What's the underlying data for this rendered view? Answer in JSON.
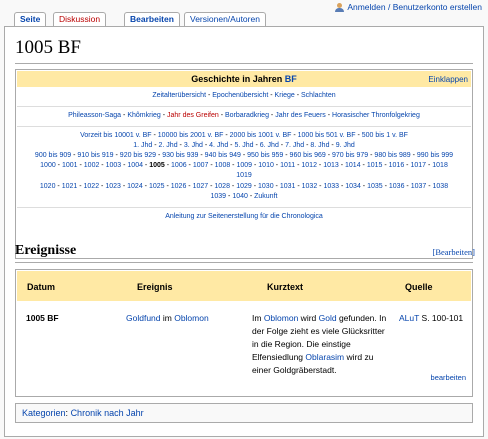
{
  "tabs": {
    "seite": "Seite",
    "diskussion": "Diskussion",
    "bearbeiten": "Bearbeiten",
    "versionen": "Versionen/Autoren"
  },
  "user_tools": {
    "login": "Anmelden / Benutzerkonto erstellen"
  },
  "page": {
    "title": "1005 BF"
  },
  "navbox": {
    "title_prefix": "Geschichte in Jahren",
    "title_link": "BF",
    "collapse": "Einklappen",
    "row1": [
      "Zeitalterübersicht",
      "Epochenübersicht",
      "Kriege",
      "Schlachten"
    ],
    "row2": [
      "Phileasson-Saga",
      "Khômkrieg",
      "Jahr des Greifen",
      "Borbaradkrieg",
      "Jahr des Feuers",
      "Horasischer Thronfolgekrieg"
    ],
    "row3": [
      "Vorzeit bis 10001 v. BF",
      "10000 bis 2001 v. BF",
      "2000 bis 1001 v. BF",
      "1000 bis 501 v. BF",
      "500 bis 1 v. BF"
    ],
    "row4": [
      "1. Jhd",
      "2. Jhd",
      "3. Jhd",
      "4. Jhd",
      "5. Jhd",
      "6. Jhd",
      "7. Jhd",
      "8. Jhd",
      "9. Jhd"
    ],
    "row5": [
      "900 bis 909",
      "910 bis 919",
      "920 bis 929",
      "930 bis 939",
      "940 bis 949",
      "950 bis 959",
      "960 bis 969",
      "970 bis 979",
      "980 bis 989",
      "990 bis 999"
    ],
    "row6": [
      "1000",
      "1001",
      "1002",
      "1003",
      "1004",
      "1005",
      "1006",
      "1007",
      "1008",
      "1009",
      "1010",
      "1011",
      "1012",
      "1013",
      "1014",
      "1015",
      "1016",
      "1017",
      "1018"
    ],
    "row7": [
      "1019"
    ],
    "row8": [
      "1020",
      "1021",
      "1022",
      "1023",
      "1024",
      "1025",
      "1026",
      "1027",
      "1028",
      "1029",
      "1030",
      "1031",
      "1032",
      "1033",
      "1034",
      "1035",
      "1036",
      "1037",
      "1038"
    ],
    "row9": [
      "1039",
      "1040",
      "Zukunft"
    ],
    "footer": "Anleitung zur Seitenerstellung für die Chronologica"
  },
  "section": {
    "title": "Ereignisse",
    "edit": "[Bearbeiten]"
  },
  "table": {
    "headers": [
      "Datum",
      "Ereignis",
      "Kurztext",
      "Quelle"
    ],
    "row": {
      "datum": "1005 BF",
      "ereignis_link1": "Goldfund",
      "ereignis_mid": " im ",
      "ereignis_link2": "Oblomon",
      "kurz_a": "Im ",
      "kurz_link1": "Oblomon",
      "kurz_b": " wird ",
      "kurz_link2": "Gold",
      "kurz_c": " gefunden. In der Folge zieht es viele Glücksritter in die Region. Die einstige Elfensiedlung ",
      "kurz_link3": "Oblarasim",
      "kurz_d": " wird zu einer Goldgräberstadt.",
      "quelle_link": "ALuT",
      "quelle_text": " S. 100-101",
      "edit": "bearbeiten"
    }
  },
  "categories": {
    "label": "Kategorien",
    "value": "Chronik nach Jahr"
  },
  "colors": {
    "accent": "#ffe9a4",
    "link": "#0645ad",
    "newlink": "#ba0000",
    "border": "#aaaaaa"
  }
}
